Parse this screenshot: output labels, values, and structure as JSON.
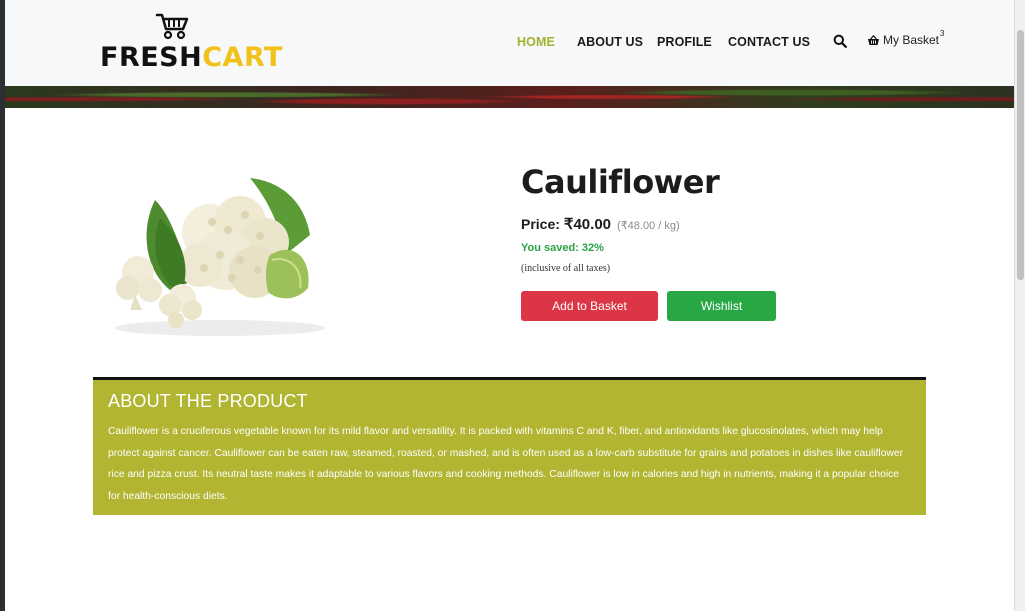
{
  "header": {
    "logo": {
      "word1": "FRESH",
      "word2": "CART",
      "icon": "shopping-cart-icon"
    },
    "nav": [
      {
        "label": "HOME",
        "active": true
      },
      {
        "label": "ABOUT US",
        "active": false
      },
      {
        "label": "PROFILE",
        "active": false
      },
      {
        "label": "CONTACT US",
        "active": false
      }
    ],
    "search_icon": "search-icon",
    "basket": {
      "icon": "basket-icon",
      "label": "My Basket",
      "count": "3"
    }
  },
  "product": {
    "name": "Cauliflower",
    "price_label": "Price:",
    "price": "₹40.00",
    "mrp": "(₹48.00 / kg)",
    "saved": "You saved: 32%",
    "tax_note": "(inclusive of all taxes)",
    "add_to_basket": "Add to Basket",
    "wishlist": "Wishlist"
  },
  "about": {
    "title": "ABOUT THE PRODUCT",
    "text": "Cauliflower is a cruciferous vegetable known for its mild flavor and versatility. It is packed with vitamins C and K, fiber, and antioxidants like glucosinolates, which may help protect against cancer. Cauliflower can be eaten raw, steamed, roasted, or mashed, and is often used as a low-carb substitute for grains and potatoes in dishes like cauliflower rice and pizza crust. Its neutral taste makes it adaptable to various flavors and cooking methods. Cauliflower is low in calories and high in nutrients, making it a popular choice for health-conscious diets."
  },
  "colors": {
    "accent": "#a4b12c",
    "about_bg": "#b1b531",
    "add_button": "#dc3545",
    "wishlist_button": "#28a745",
    "saved_text": "#2aa244"
  }
}
